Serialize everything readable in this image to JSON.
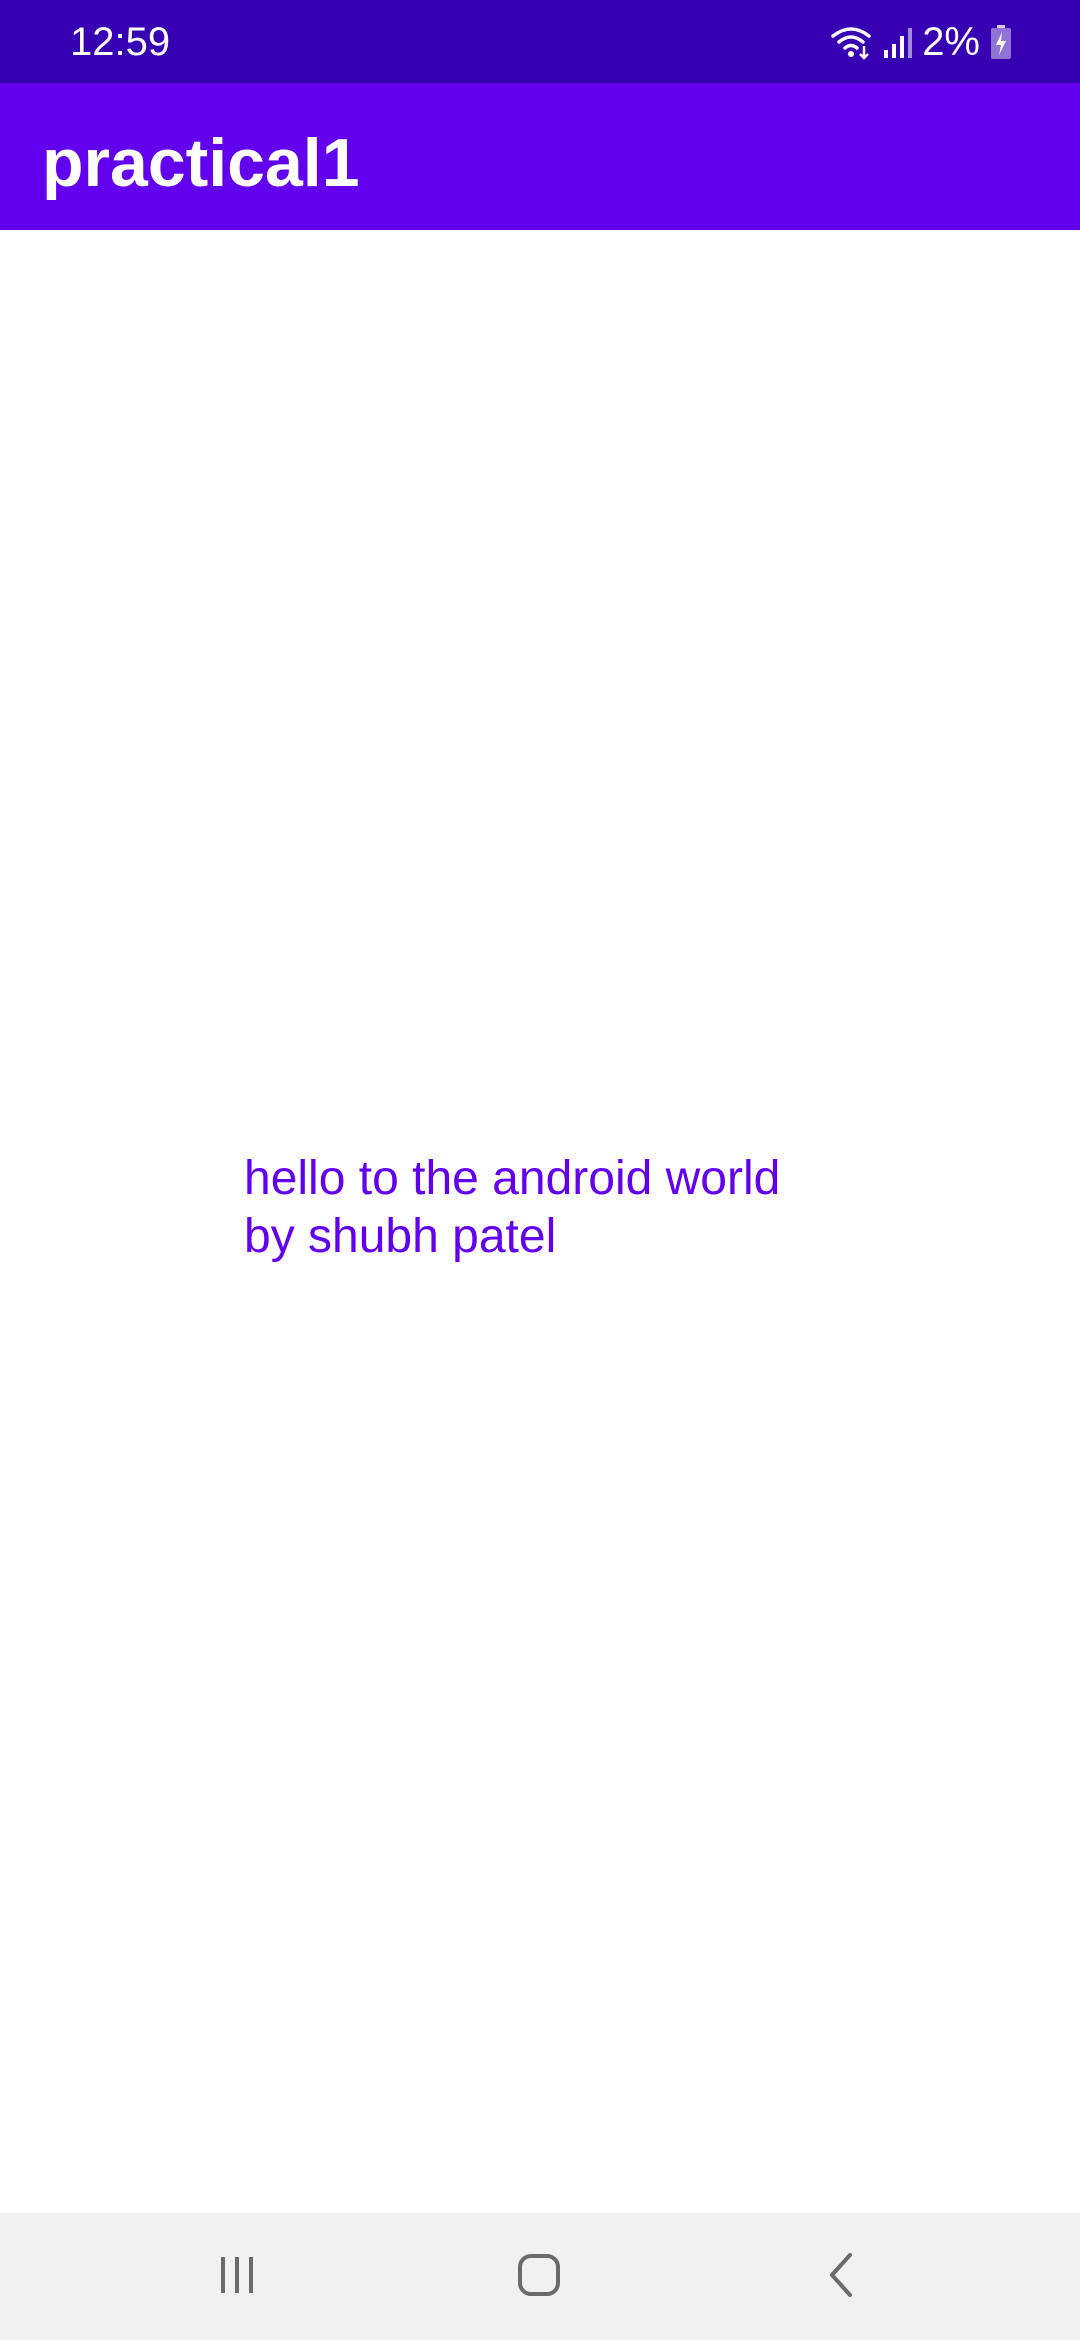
{
  "status_bar": {
    "time": "12:59",
    "battery_percent": "2%",
    "icons": [
      "wifi-icon",
      "signal-icon",
      "battery-charging-icon"
    ],
    "background_color": "#3700b3"
  },
  "app_bar": {
    "title": "practical1",
    "background_color": "#6200ee"
  },
  "content": {
    "message_line1": "hello to the android world",
    "message_line2": "by shubh patel",
    "text_color": "#6200ee"
  },
  "nav_bar": {
    "buttons": [
      "recents-icon",
      "home-icon",
      "back-icon"
    ],
    "background_color": "#f1f1f1"
  }
}
